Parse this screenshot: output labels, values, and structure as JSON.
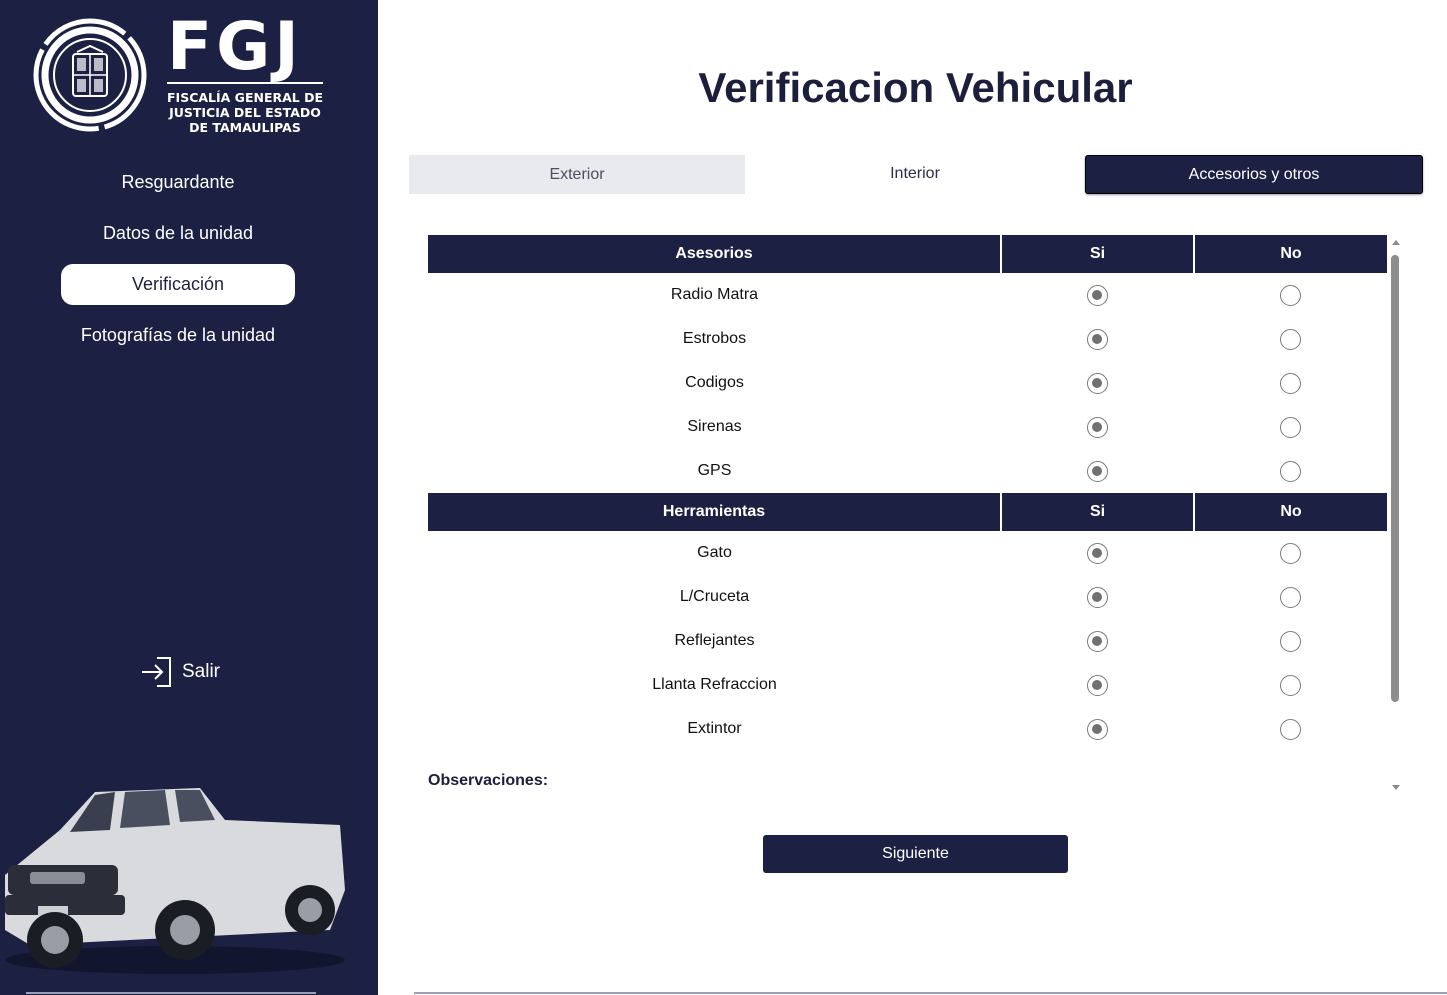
{
  "sidebar": {
    "logo": {
      "acronym": "FGJ",
      "line1": "FISCALÍA GENERAL DE",
      "line2": "JUSTICIA DEL ESTADO",
      "line3": "DE TAMAULIPAS"
    },
    "nav": [
      {
        "label": "Resguardante",
        "active": false
      },
      {
        "label": "Datos de la unidad",
        "active": false
      },
      {
        "label": "Verificación",
        "active": true
      },
      {
        "label": "Fotografías de la unidad",
        "active": false
      }
    ],
    "logout_label": "Salir",
    "logout_icon": "logout-icon"
  },
  "main": {
    "title": "Verificacion Vehicular",
    "tabs": [
      {
        "label": "Exterior"
      },
      {
        "label": "Interior"
      },
      {
        "label": "Accesorios y otros"
      }
    ],
    "sections": [
      {
        "header": "Asesorios",
        "yes": "Si",
        "no": "No",
        "rows": [
          {
            "label": "Radio Matra",
            "value": "Si"
          },
          {
            "label": "Estrobos",
            "value": "Si"
          },
          {
            "label": "Codigos",
            "value": "Si"
          },
          {
            "label": "Sirenas",
            "value": "Si"
          },
          {
            "label": "GPS",
            "value": "Si"
          }
        ]
      },
      {
        "header": "Herramientas",
        "yes": "Si",
        "no": "No",
        "rows": [
          {
            "label": "Gato",
            "value": "Si"
          },
          {
            "label": "L/Cruceta",
            "value": "Si"
          },
          {
            "label": "Reflejantes",
            "value": "Si"
          },
          {
            "label": "Llanta Refraccion",
            "value": "Si"
          },
          {
            "label": "Extintor",
            "value": "Si"
          }
        ]
      }
    ],
    "observations_label": "Observaciones:",
    "next_label": "Siguiente"
  },
  "colors": {
    "navy": "#1c2143",
    "tab_inactive": "#e9eaee",
    "radio_checked": "#707070"
  }
}
